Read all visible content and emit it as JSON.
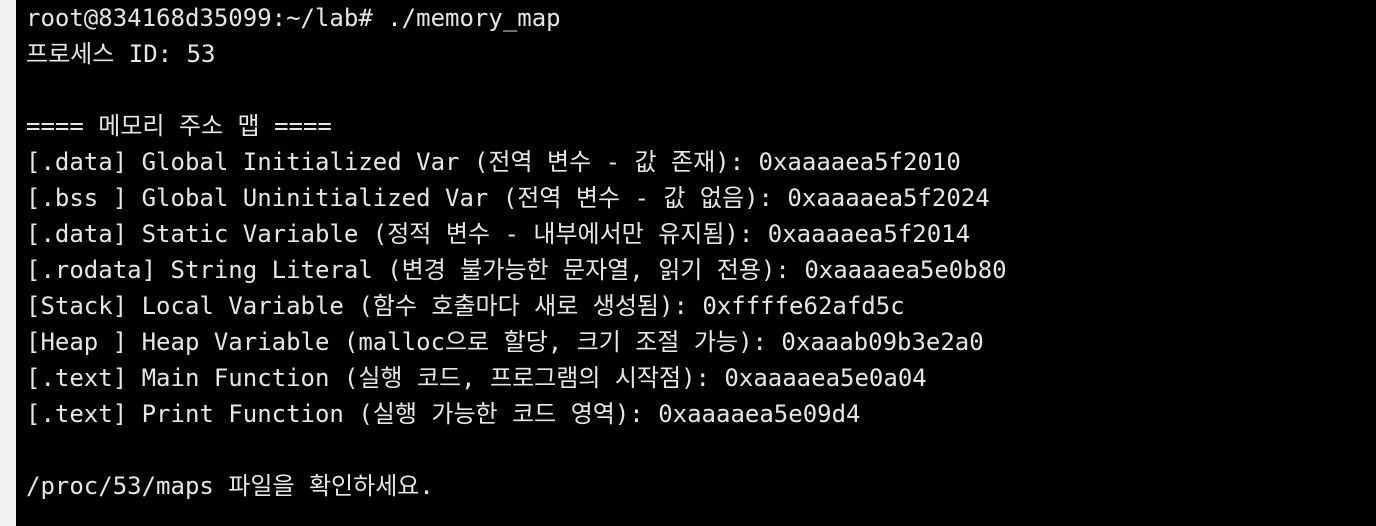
{
  "terminal": {
    "prompt": "root@834168d35099:~/lab# ./memory_map",
    "pid_line": "프로세스 ID: 53",
    "blank1": "",
    "header": "==== 메모리 주소 맵 ====",
    "entries": [
      "[.data] Global Initialized Var (전역 변수 - 값 존재): 0xaaaaea5f2010",
      "[.bss ] Global Uninitialized Var (전역 변수 - 값 없음): 0xaaaaea5f2024",
      "[.data] Static Variable (정적 변수 - 내부에서만 유지됨): 0xaaaaea5f2014",
      "[.rodata] String Literal (변경 불가능한 문자열, 읽기 전용): 0xaaaaea5e0b80",
      "[Stack] Local Variable (함수 호출마다 새로 생성됨): 0xffffe62afd5c",
      "[Heap ] Heap Variable (malloc으로 할당, 크기 조절 가능): 0xaaab09b3e2a0",
      "[.text] Main Function (실행 코드, 프로그램의 시작점): 0xaaaaea5e0a04",
      "[.text] Print Function (실행 가능한 코드 영역): 0xaaaaea5e09d4"
    ],
    "blank2": "",
    "footer": "/proc/53/maps 파일을 확인하세요."
  },
  "colors": {
    "background": "#000000",
    "text": "#e6e6e6",
    "outer": "#f2f2f2"
  }
}
